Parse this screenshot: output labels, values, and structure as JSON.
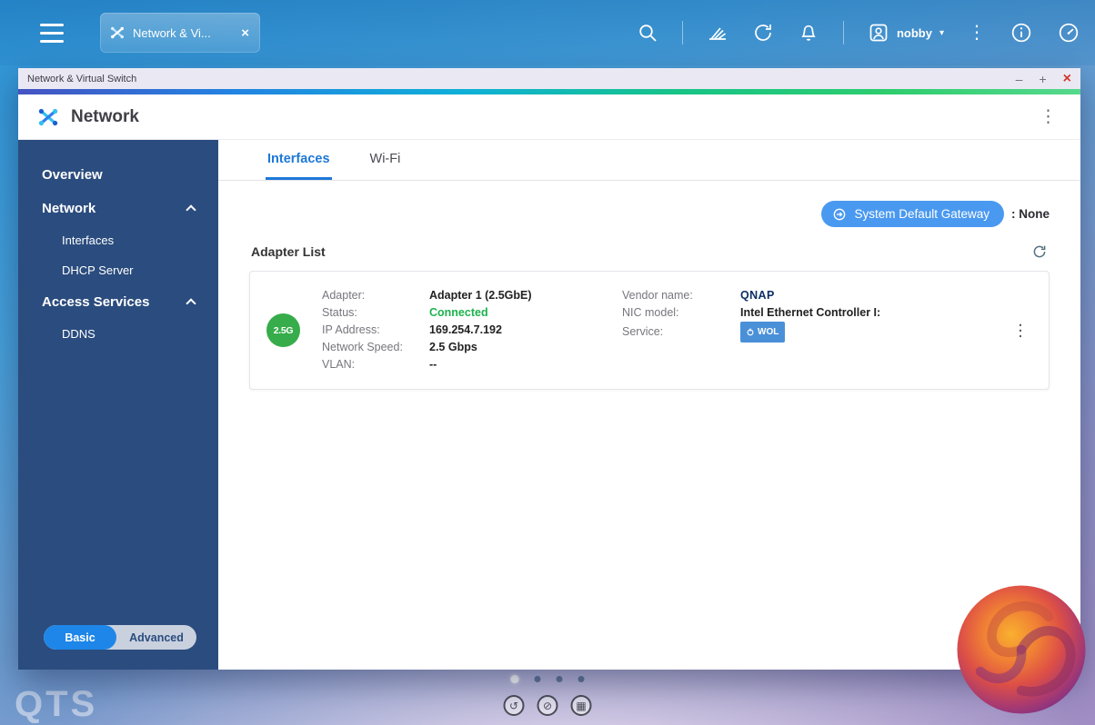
{
  "colors": {
    "accent_blue": "#1d78d8",
    "sidebar_blue": "#2b4c7e",
    "status_connected_green": "#1db24c",
    "gateway_button_blue": "#4a99f0",
    "adapter_badge_green": "#36ad4a",
    "wol_badge_blue": "#4a90d8",
    "close_red": "#d2352b"
  },
  "icons": {
    "minimize": "–",
    "maximize": "+",
    "close": "×",
    "tab_close": "×",
    "kebab": "⋮",
    "caret_down": "▾",
    "more_vertical": "⋮",
    "nav_back": "↺",
    "nav_slash": "⊘",
    "nav_grid": "▦"
  },
  "taskbar": {
    "tab_label": "Network & Vi...",
    "username": "nobby"
  },
  "window": {
    "title": "Network & Virtual Switch",
    "app_title": "Network"
  },
  "sidebar": {
    "items": [
      {
        "label": "Overview"
      },
      {
        "label": "Network"
      },
      {
        "label": "Interfaces"
      },
      {
        "label": "DHCP Server"
      },
      {
        "label": "Access Services"
      },
      {
        "label": "DDNS"
      }
    ],
    "toggle": {
      "basic": "Basic",
      "advanced": "Advanced",
      "active": "Basic"
    }
  },
  "main": {
    "tabs": [
      {
        "label": "Interfaces"
      },
      {
        "label": "Wi-Fi"
      }
    ],
    "gateway": {
      "button_label": "System Default Gateway",
      "value": ": None"
    },
    "adapter_list_title": "Adapter List",
    "adapter": {
      "badge_label": "2.5G",
      "left_fields": [
        {
          "label": "Adapter:",
          "value": "Adapter 1 (2.5GbE)"
        },
        {
          "label": "Status:",
          "value": "Connected"
        },
        {
          "label": "IP Address:",
          "value": "169.254.7.192"
        },
        {
          "label": "Network Speed:",
          "value": "2.5 Gbps"
        },
        {
          "label": "VLAN:",
          "value": "--"
        }
      ],
      "right_fields": [
        {
          "label": "Vendor name:",
          "value": "QNAP"
        },
        {
          "label": "NIC model:",
          "value": "Intel Ethernet Controller I:"
        },
        {
          "label": "Service:",
          "value": "WOL"
        }
      ]
    }
  },
  "desktop": {
    "qts_logo": "QTS"
  }
}
